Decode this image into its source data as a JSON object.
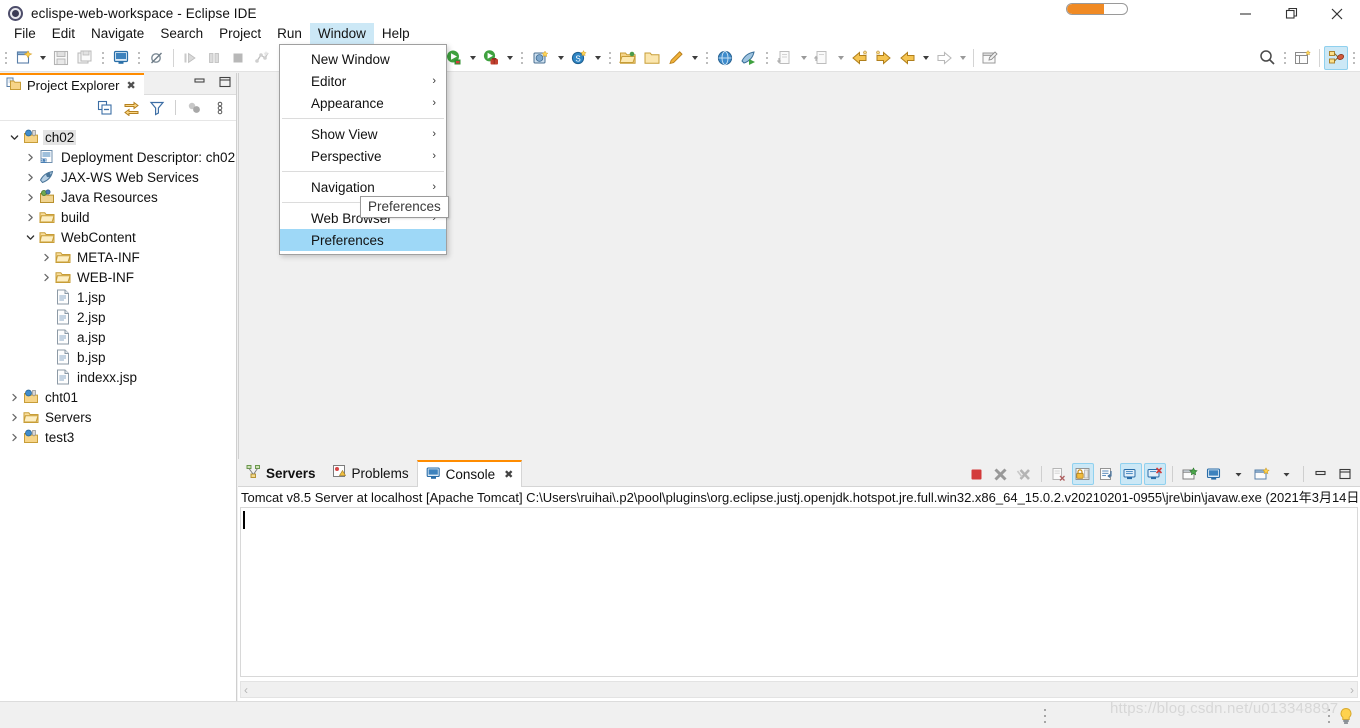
{
  "window": {
    "title": "eclispe-web-workspace - Eclipse IDE",
    "app_icon": "eclipse-icon",
    "progress_label": "",
    "minimize_label": "Minimize",
    "maximize_label": "Restore",
    "close_label": "Close"
  },
  "menubar": {
    "items": [
      {
        "label": "File",
        "active": false
      },
      {
        "label": "Edit",
        "active": false
      },
      {
        "label": "Navigate",
        "active": false
      },
      {
        "label": "Search",
        "active": false
      },
      {
        "label": "Project",
        "active": false
      },
      {
        "label": "Run",
        "active": false
      },
      {
        "label": "Window",
        "active": true
      },
      {
        "label": "Help",
        "active": false
      }
    ]
  },
  "window_menu": {
    "items": [
      {
        "label": "New Window",
        "submenu": false,
        "highlight": false
      },
      {
        "label": "Editor",
        "submenu": true,
        "highlight": false
      },
      {
        "label": "Appearance",
        "submenu": true,
        "highlight": false
      },
      {
        "separator_after": true
      },
      {
        "label": "Show View",
        "submenu": true,
        "highlight": false
      },
      {
        "label": "Perspective",
        "submenu": true,
        "highlight": false
      },
      {
        "separator_after": true
      },
      {
        "label": "Navigation",
        "submenu": true,
        "highlight": false
      },
      {
        "separator_after": true
      },
      {
        "label": "Web Browser",
        "submenu": true,
        "highlight": false
      },
      {
        "label": "Preferences",
        "submenu": false,
        "highlight": true
      }
    ],
    "tooltip": "Preferences"
  },
  "toolbar": {
    "buttons": [
      "new-wizard-icon",
      "save-icon",
      "save-all-icon",
      "new-jsp-file-icon",
      "toggle-breakpoint-icon",
      "step-over-icon",
      "pause-icon",
      "terminate-icon",
      "debug-last-icon",
      "skip-breakpoints-icon",
      "external-tools-icon",
      "run-icon",
      "debug-icon",
      "new-ejb-project-icon",
      "new-server-icon",
      "open-folder-icon",
      "open-type-icon",
      "quick-access-icon",
      "open-web-browser-icon",
      "run-on-server-icon",
      "next-annotation-icon",
      "previous-annotation-icon",
      "back-icon",
      "forward-icon",
      "previous-edit-icon",
      "next-edit-icon",
      "new-editor-icon",
      "search-icon",
      "new-perspective-icon",
      "java-ee-perspective-icon"
    ]
  },
  "explorer": {
    "tab_title": "Project Explorer",
    "tab_icon": "project-explorer-icon",
    "close_glyph": "✖",
    "minimize_label": "Minimize",
    "maximize_label": "Maximize",
    "tools": [
      "collapse-all-icon",
      "link-with-editor-icon",
      "filter-icon",
      "focus-on-active-task-icon",
      "view-menu-icon"
    ],
    "tree": [
      {
        "label": "ch02",
        "depth": 0,
        "icon": "web-project-icon",
        "twist": "expanded",
        "selected": true
      },
      {
        "label": "Deployment Descriptor: ch02",
        "depth": 1,
        "icon": "deployment-descriptor-icon",
        "twist": "collapsed",
        "selected": false
      },
      {
        "label": "JAX-WS Web Services",
        "depth": 1,
        "icon": "jaxws-icon",
        "twist": "collapsed",
        "selected": false
      },
      {
        "label": "Java Resources",
        "depth": 1,
        "icon": "java-resources-icon",
        "twist": "collapsed",
        "selected": false
      },
      {
        "label": "build",
        "depth": 1,
        "icon": "folder-icon",
        "twist": "collapsed",
        "selected": false
      },
      {
        "label": "WebContent",
        "depth": 1,
        "icon": "folder-icon",
        "twist": "expanded",
        "selected": false
      },
      {
        "label": "META-INF",
        "depth": 2,
        "icon": "folder-icon",
        "twist": "collapsed",
        "selected": false
      },
      {
        "label": "WEB-INF",
        "depth": 2,
        "icon": "folder-icon",
        "twist": "collapsed",
        "selected": false
      },
      {
        "label": "1.jsp",
        "depth": 2,
        "icon": "jsp-file-icon",
        "twist": "none",
        "selected": false
      },
      {
        "label": "2.jsp",
        "depth": 2,
        "icon": "jsp-file-icon",
        "twist": "none",
        "selected": false
      },
      {
        "label": "a.jsp",
        "depth": 2,
        "icon": "jsp-file-icon",
        "twist": "none",
        "selected": false
      },
      {
        "label": "b.jsp",
        "depth": 2,
        "icon": "jsp-file-icon",
        "twist": "none",
        "selected": false
      },
      {
        "label": "indexx.jsp",
        "depth": 2,
        "icon": "jsp-file-icon",
        "twist": "none",
        "selected": false
      },
      {
        "label": "cht01",
        "depth": 0,
        "icon": "web-project-icon",
        "twist": "collapsed",
        "selected": false
      },
      {
        "label": "Servers",
        "depth": 0,
        "icon": "folder-icon",
        "twist": "collapsed",
        "selected": false
      },
      {
        "label": "test3",
        "depth": 0,
        "icon": "web-project-icon",
        "twist": "collapsed",
        "selected": false
      }
    ]
  },
  "bottom_panel": {
    "tabs": [
      {
        "label": "Servers",
        "icon": "servers-icon",
        "active": false,
        "bold": true,
        "closable": false
      },
      {
        "label": "Problems",
        "icon": "problems-icon",
        "active": false,
        "bold": false,
        "closable": false
      },
      {
        "label": "Console",
        "icon": "console-icon",
        "active": true,
        "bold": false,
        "closable": true
      }
    ],
    "close_glyph": "✖",
    "tools": [
      {
        "name": "terminate-icon",
        "on": false
      },
      {
        "name": "remove-launch-icon",
        "on": false
      },
      {
        "name": "remove-all-terminated-icon",
        "on": false
      },
      {
        "name": "clear-console-icon",
        "on": false
      },
      {
        "name": "scroll-lock-icon",
        "on": true
      },
      {
        "name": "word-wrap-icon",
        "on": false
      },
      {
        "name": "show-console-on-output-icon",
        "on": true
      },
      {
        "name": "show-console-on-error-icon",
        "on": true
      },
      {
        "name": "pin-console-icon",
        "on": false
      },
      {
        "name": "display-selected-console-icon",
        "on": false
      },
      {
        "name": "open-console-icon",
        "on": false
      },
      {
        "name": "minimize-icon",
        "on": false
      },
      {
        "name": "maximize-icon",
        "on": false
      }
    ],
    "console_title": "Tomcat v8.5 Server at localhost [Apache Tomcat] C:\\Users\\ruihai\\.p2\\pool\\plugins\\org.eclipse.justj.openjdk.hotspot.jre.full.win32.x86_64_15.0.2.v20210201-0955\\jre\\bin\\javaw.exe  (2021年3月14日",
    "console_body_text": "",
    "scroll_left_glyph": "‹",
    "scroll_right_glyph": "›"
  },
  "statusbar": {
    "watermark": "https://blog.csdn.net/u013348897",
    "tip_icon": "lightbulb-icon"
  },
  "colors": {
    "accent_orange": "#ff8c00",
    "selection_blue": "#9ed8f7",
    "toolbar_active": "#cce8f6",
    "panel_gray": "#f0f0f0",
    "border_gray": "#d5d5d5"
  }
}
